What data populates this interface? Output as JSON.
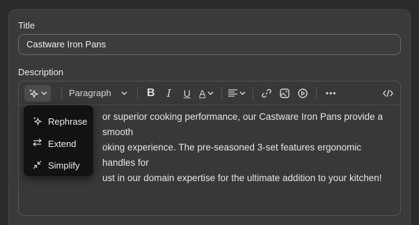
{
  "form": {
    "title_label": "Title",
    "title_value": "Castware Iron Pans",
    "description_label": "Description"
  },
  "toolbar": {
    "ai_icon": "sparkles-icon",
    "block_style": "Paragraph",
    "bold": "B",
    "italic": "I",
    "underline": "U",
    "text_color": "A",
    "more": "•••"
  },
  "editor": {
    "content_lines": [
      "or superior cooking performance, our Castware Iron Pans provide a smooth",
      "oking experience. The pre-seasoned 3-set features ergonomic handles for",
      "ust in our domain expertise for the ultimate addition to your kitchen!"
    ]
  },
  "ai_menu": {
    "items": [
      {
        "label": "Rephrase",
        "icon": "sparkle-icon"
      },
      {
        "label": "Extend",
        "icon": "extend-arrows-icon"
      },
      {
        "label": "Simplify",
        "icon": "simplify-arrows-icon"
      }
    ]
  },
  "colors": {
    "background": "#2b2b2b",
    "card": "#3a3a3a",
    "menu": "#121212",
    "text": "#e8e8e8"
  }
}
